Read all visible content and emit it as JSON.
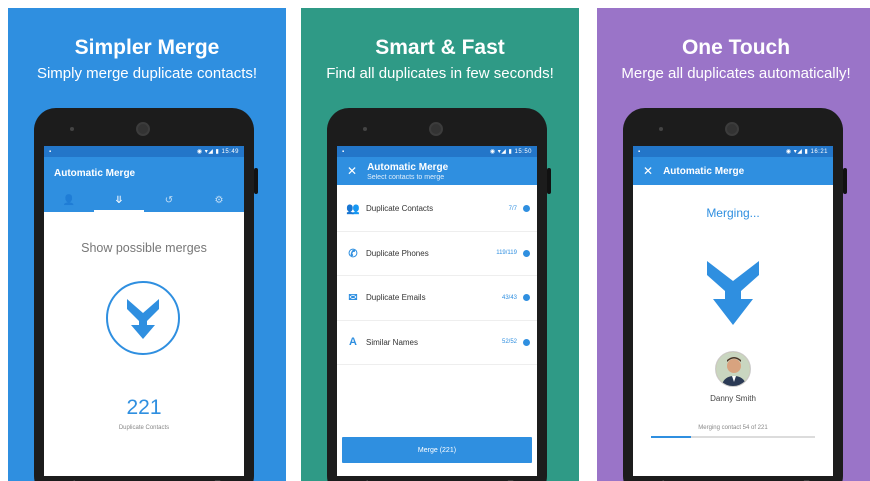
{
  "panels": [
    {
      "headline": "Simpler Merge",
      "subline": "Simply merge duplicate contacts!",
      "status_time": "15:49",
      "app_title": "Automatic Merge",
      "tabs": [
        {
          "icon": "person-icon",
          "glyph": "👤"
        },
        {
          "icon": "merge-icon",
          "glyph": "⤋"
        },
        {
          "icon": "history-icon",
          "glyph": "↺"
        },
        {
          "icon": "settings-gear-icon",
          "glyph": "⚙"
        }
      ],
      "prompt_text": "Show possible merges",
      "count_value": "221",
      "count_label": "Duplicate Contacts"
    },
    {
      "headline": "Smart & Fast",
      "subline": "Find all duplicates in few seconds!",
      "status_time": "15:50",
      "app_title": "Automatic Merge",
      "app_subtitle": "Select contacts to merge",
      "rows": [
        {
          "icon": "contacts-icon",
          "glyph": "👥",
          "label": "Duplicate Contacts",
          "count": "7/7"
        },
        {
          "icon": "phone-icon",
          "glyph": "✆",
          "label": "Duplicate Phones",
          "count": "119/119"
        },
        {
          "icon": "email-icon",
          "glyph": "✉",
          "label": "Duplicate Emails",
          "count": "43/43"
        },
        {
          "icon": "name-icon",
          "glyph": "A",
          "label": "Similar Names",
          "count": "52/52"
        }
      ],
      "button_label": "Merge (221)"
    },
    {
      "headline": "One Touch",
      "subline": "Merge all duplicates automatically!",
      "status_time": "16:21",
      "app_title": "Automatic Merge",
      "status_text": "Merging...",
      "person_name": "Danny Smith",
      "progress_text": "Merging contact 54 of 221",
      "progress_fraction": 0.244
    }
  ],
  "colors": {
    "panel1_bg": "#2f8fe0",
    "panel2_bg": "#2f9a86",
    "panel3_bg": "#9a74c8",
    "accent": "#2f8fe0"
  },
  "status_icons": "◉ ▾◢ ▮"
}
